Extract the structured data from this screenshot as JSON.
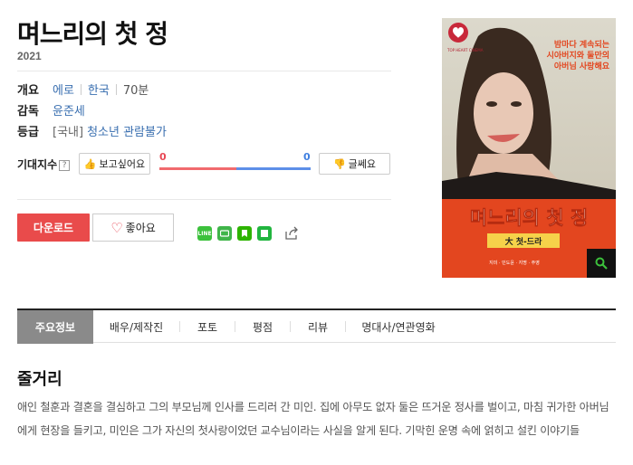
{
  "movie": {
    "title": "며느리의 첫 정",
    "year": "2021"
  },
  "info": {
    "overview_label": "개요",
    "genre": "에로",
    "country": "한국",
    "runtime": "70분",
    "director_label": "감독",
    "director": "윤준세",
    "rating_label": "등급",
    "rating_region": "[국내]",
    "rating": "청소년 관람불가"
  },
  "expectation": {
    "label": "기대지수",
    "help": "?",
    "want_label": "보고싶어요",
    "want_count": "0",
    "nah_label": "글쎄요",
    "nah_count": "0"
  },
  "actions": {
    "download_label": "다운로드",
    "like_label": "좋아요"
  },
  "share": {
    "line_text": "LINE"
  },
  "poster": {
    "badge": "TOP HEART CINEMA",
    "tagline_1": "밤마다 계속되는",
    "tagline_2": "시아버지와 둘만의",
    "tagline_3": "아버님 사랑해요",
    "title_art": "며느리의 첫 정",
    "subtitle_art": "大 첫-드라",
    "credits": "지미 · 민도윤 · 지명 · 주영",
    "accent_color": "#e3461f",
    "bg_color": "#d5d2c4"
  },
  "tabs": [
    {
      "label": "주요정보",
      "active": true
    },
    {
      "label": "배우/제작진",
      "active": false
    },
    {
      "label": "포토",
      "active": false
    },
    {
      "label": "평점",
      "active": false
    },
    {
      "label": "리뷰",
      "active": false
    },
    {
      "label": "명대사/연관영화",
      "active": false
    }
  ],
  "synopsis": {
    "heading": "줄거리",
    "text": "애인 철훈과 결혼을 결심하고 그의 부모님께 인사를 드리러 간 미인. 집에 아무도 없자 둘은 뜨거운 정사를 벌이고, 마침 귀가한 아버님에게 현장을 들키고, 미인은 그가 자신의 첫사랑이었던 교수님이라는 사실을 알게 된다. 기막힌 운명 속에 얽히고 설킨 이야기들"
  }
}
